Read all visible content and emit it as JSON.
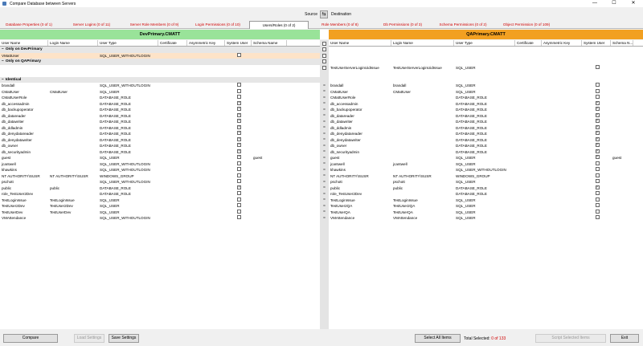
{
  "window": {
    "title": "Compare Database between Servers",
    "minimize": "—",
    "maximize": "☐",
    "close": "✕"
  },
  "source_label": "Source",
  "swap_icon": "⇆",
  "destination_label": "Destination",
  "tabs": [
    {
      "label": "Database Properties (0 of 1)"
    },
    {
      "label": "Server Logins (0 of 11)"
    },
    {
      "label": "Server Role Members (0 of 9)"
    },
    {
      "label": "Login Permissions (0 of 10)"
    },
    {
      "label": "Users/Roles (0 of 2)",
      "selected": true
    },
    {
      "label": "Role Members (0 of 8)"
    },
    {
      "label": "Db Permissions (0 of 3)"
    },
    {
      "label": "Schema Permissions (0 of 2)"
    },
    {
      "label": "Object Permission (0 of 109)"
    }
  ],
  "left": {
    "server": "DevPrimary.CMATT",
    "columns": [
      "User Name",
      "Login Name",
      "User Type",
      "Certificate",
      "Asymmetric Key",
      "System User",
      "Schema Name"
    ]
  },
  "right": {
    "server": "QAPrimary.CMATT",
    "columns": [
      "User Name",
      "Login Name",
      "User Type",
      "Certificate",
      "Asymmetric Key",
      "System User",
      "Schema N..."
    ]
  },
  "groups": {
    "only_dev": "Only on DevPrimary",
    "only_qa": "Only on QAPrimary",
    "identical": "Identical",
    "expander": "−"
  },
  "only_dev_rows": [
    {
      "user": "VMattUser",
      "login": "",
      "type": "SQL_USER_WITHOUTLOGIN",
      "sys": false,
      "schema": ""
    }
  ],
  "only_qa_rows": [
    {
      "user": "TestUserServerLoginUidIssue",
      "login": "TestUserServerLoginUidIssue",
      "type": "SQL_USER",
      "sys": false,
      "schema": ""
    }
  ],
  "identical_rows": [
    {
      "user": "brandall",
      "login": "",
      "type": "SQL_USER_WITHOUTLOGIN",
      "sys": false,
      "schema": "",
      "rlogin": "brandall",
      "rtype": "SQL_USER"
    },
    {
      "user": "CMattUser",
      "login": "CMattUser",
      "type": "SQL_USER",
      "sys": false,
      "schema": "",
      "rlogin": "CMattUser",
      "rtype": "SQL_USER"
    },
    {
      "user": "CMattUserRole",
      "login": "",
      "type": "DATABASE_ROLE",
      "sys": false,
      "schema": "",
      "rlogin": "",
      "rtype": "DATABASE_ROLE"
    },
    {
      "user": "db_accessadmin",
      "login": "",
      "type": "DATABASE_ROLE",
      "sys": true,
      "schema": "",
      "rlogin": "",
      "rtype": "DATABASE_ROLE"
    },
    {
      "user": "db_backupoperator",
      "login": "",
      "type": "DATABASE_ROLE",
      "sys": true,
      "schema": "",
      "rlogin": "",
      "rtype": "DATABASE_ROLE"
    },
    {
      "user": "db_datareader",
      "login": "",
      "type": "DATABASE_ROLE",
      "sys": true,
      "schema": "",
      "rlogin": "",
      "rtype": "DATABASE_ROLE"
    },
    {
      "user": "db_datawriter",
      "login": "",
      "type": "DATABASE_ROLE",
      "sys": true,
      "schema": "",
      "rlogin": "",
      "rtype": "DATABASE_ROLE"
    },
    {
      "user": "db_ddladmin",
      "login": "",
      "type": "DATABASE_ROLE",
      "sys": true,
      "schema": "",
      "rlogin": "",
      "rtype": "DATABASE_ROLE"
    },
    {
      "user": "db_denydatareader",
      "login": "",
      "type": "DATABASE_ROLE",
      "sys": true,
      "schema": "",
      "rlogin": "",
      "rtype": "DATABASE_ROLE"
    },
    {
      "user": "db_denydatawriter",
      "login": "",
      "type": "DATABASE_ROLE",
      "sys": true,
      "schema": "",
      "rlogin": "",
      "rtype": "DATABASE_ROLE"
    },
    {
      "user": "db_owner",
      "login": "",
      "type": "DATABASE_ROLE",
      "sys": true,
      "schema": "",
      "rlogin": "",
      "rtype": "DATABASE_ROLE"
    },
    {
      "user": "db_securityadmin",
      "login": "",
      "type": "DATABASE_ROLE",
      "sys": true,
      "schema": "",
      "rlogin": "",
      "rtype": "DATABASE_ROLE"
    },
    {
      "user": "guest",
      "login": "",
      "type": "SQL_USER",
      "sys": true,
      "schema": "guest",
      "rlogin": "",
      "rtype": "SQL_USER"
    },
    {
      "user": "jcantwell",
      "login": "",
      "type": "SQL_USER_WITHOUTLOGIN",
      "sys": false,
      "schema": "",
      "rlogin": "jcantwell",
      "rtype": "SQL_USER"
    },
    {
      "user": "khawkins",
      "login": "",
      "type": "SQL_USER_WITHOUTLOGIN",
      "sys": false,
      "schema": "",
      "rlogin": "",
      "rtype": "SQL_USER_WITHOUTLOGIN"
    },
    {
      "user": "NT AUTHORITY\\SUSR",
      "login": "NT AUTHORITY\\SUSR",
      "type": "WINDOWS_GROUP",
      "sys": false,
      "schema": "",
      "rlogin": "NT AUTHORITY\\SUSR",
      "rtype": "WINDOWS_GROUP"
    },
    {
      "user": "pschott",
      "login": "",
      "type": "SQL_USER_WITHOUTLOGIN",
      "sys": false,
      "schema": "",
      "rlogin": "pschott",
      "rtype": "SQL_USER"
    },
    {
      "user": "public",
      "login": "public",
      "type": "DATABASE_ROLE",
      "sys": true,
      "schema": "",
      "rlogin": "public",
      "rtype": "DATABASE_ROLE"
    },
    {
      "user": "role_TestUser2Dev",
      "login": "",
      "type": "DATABASE_ROLE",
      "sys": false,
      "schema": "",
      "rlogin": "",
      "rtype": "DATABASE_ROLE"
    },
    {
      "user": "TestLoginIssue",
      "login": "TestLoginIssue",
      "type": "SQL_USER",
      "sys": false,
      "schema": "",
      "rlogin": "TestLoginIssue",
      "rtype": "SQL_USER"
    },
    {
      "user": "TestUser2Dev",
      "login": "TestUser2Dev",
      "type": "SQL_USER",
      "sys": false,
      "schema": "",
      "ruser": "TestUser2QA",
      "rlogin": "TestUser2QA",
      "rtype": "SQL_USER"
    },
    {
      "user": "TestUserDev",
      "login": "TestUserDev",
      "type": "SQL_USER",
      "sys": false,
      "schema": "",
      "ruser": "TestUserQA",
      "rlogin": "TestUserQA",
      "rtype": "SQL_USER"
    },
    {
      "user": "VMAttendance",
      "login": "",
      "type": "SQL_USER_WITHOUTLOGIN",
      "sys": false,
      "schema": "",
      "rlogin": "VMAttendance",
      "rtype": "SQL_USER"
    }
  ],
  "bottom": {
    "compare": "Compare",
    "load_settings": "Load Settings",
    "save_settings": "Save Settings",
    "select_all": "Select All Items",
    "total_label": "Total Selected:",
    "total_value": "0 of 133",
    "script_selected": "Script Selected Items",
    "exit": "Exit"
  }
}
